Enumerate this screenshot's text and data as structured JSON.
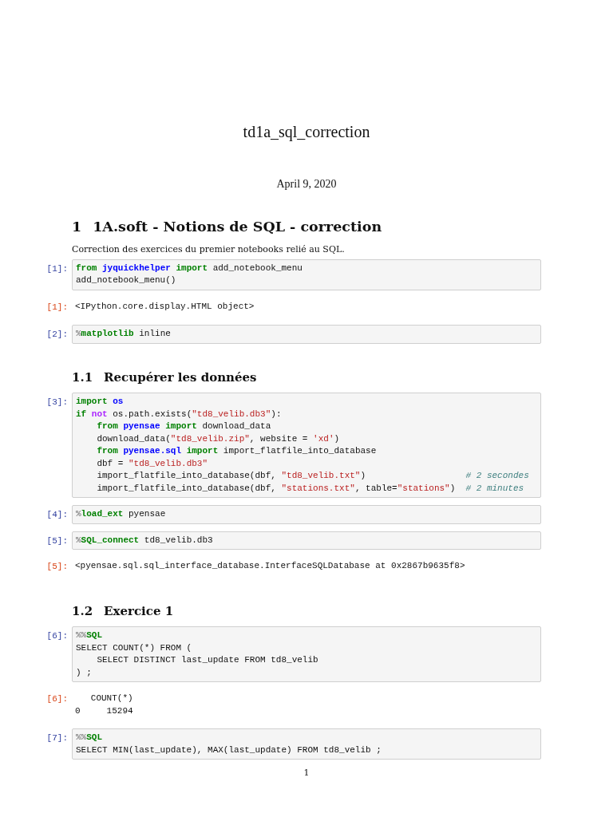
{
  "document": {
    "title": "td1a_sql_correction",
    "date": "April 9, 2020"
  },
  "cells": [
    {
      "kind": "section",
      "number": "1",
      "text": "1A.soft - Notions de SQL - correction"
    },
    {
      "kind": "paragraph",
      "text": "Correction des exercices du premier notebooks relié au SQL."
    },
    {
      "kind": "input",
      "prompt": "[1]:",
      "lines": [
        [
          {
            "kind": "kw",
            "text": "from "
          },
          {
            "kind": "ns",
            "text": "jyquickhelper "
          },
          {
            "kind": "kw",
            "text": "import"
          },
          {
            "kind": "plain",
            "text": " add_notebook_menu"
          }
        ],
        [
          {
            "kind": "plain",
            "text": "add_notebook_menu()"
          }
        ]
      ]
    },
    {
      "kind": "output",
      "prompt": "[1]:",
      "lines": [
        [
          {
            "kind": "plain",
            "text": "<IPython.core.display.HTML object>"
          }
        ]
      ]
    },
    {
      "kind": "input",
      "prompt": "[2]:",
      "lines": [
        [
          {
            "kind": "pct",
            "text": "%"
          },
          {
            "kind": "kw",
            "text": "matplotlib"
          },
          {
            "kind": "plain",
            "text": " inline"
          }
        ]
      ]
    },
    {
      "kind": "subsection",
      "number": "1.1",
      "text": "Recupérer les données"
    },
    {
      "kind": "input",
      "prompt": "[3]:",
      "lines": [
        [
          {
            "kind": "kw",
            "text": "import "
          },
          {
            "kind": "ns",
            "text": "os"
          }
        ],
        [
          {
            "kind": "kw",
            "text": "if "
          },
          {
            "kind": "opw",
            "text": "not"
          },
          {
            "kind": "plain",
            "text": " os.path.exists("
          },
          {
            "kind": "str",
            "text": "\"td8_velib.db3\""
          },
          {
            "kind": "plain",
            "text": "):"
          }
        ],
        [
          {
            "kind": "kw",
            "text": "    from "
          },
          {
            "kind": "ns",
            "text": "pyensae "
          },
          {
            "kind": "kw",
            "text": "import"
          },
          {
            "kind": "plain",
            "text": " download_data"
          }
        ],
        [
          {
            "kind": "plain",
            "text": "    download_data("
          },
          {
            "kind": "str",
            "text": "\"td8_velib.zip\""
          },
          {
            "kind": "plain",
            "text": ", website = "
          },
          {
            "kind": "str",
            "text": "'xd'"
          },
          {
            "kind": "plain",
            "text": ")"
          }
        ],
        [
          {
            "kind": "kw",
            "text": "    from "
          },
          {
            "kind": "ns",
            "text": "pyensae.sql "
          },
          {
            "kind": "kw",
            "text": "import"
          },
          {
            "kind": "plain",
            "text": " import_flatfile_into_database"
          }
        ],
        [
          {
            "kind": "plain",
            "text": "    dbf = "
          },
          {
            "kind": "str",
            "text": "\"td8_velib.db3\""
          }
        ],
        [
          {
            "kind": "plain",
            "text": "    import_flatfile_into_database(dbf, "
          },
          {
            "kind": "str",
            "text": "\"td8_velib.txt\""
          },
          {
            "kind": "plain",
            "text": ")                   "
          },
          {
            "kind": "cmt",
            "text": "# 2 secondes"
          }
        ],
        [
          {
            "kind": "plain",
            "text": "    import_flatfile_into_database(dbf, "
          },
          {
            "kind": "str",
            "text": "\"stations.txt\""
          },
          {
            "kind": "plain",
            "text": ", table="
          },
          {
            "kind": "str",
            "text": "\"stations\""
          },
          {
            "kind": "plain",
            "text": ")  "
          },
          {
            "kind": "cmt",
            "text": "# 2 minutes"
          }
        ]
      ]
    },
    {
      "kind": "input",
      "prompt": "[4]:",
      "lines": [
        [
          {
            "kind": "pct",
            "text": "%"
          },
          {
            "kind": "kw",
            "text": "load_ext"
          },
          {
            "kind": "plain",
            "text": " pyensae"
          }
        ]
      ]
    },
    {
      "kind": "input",
      "prompt": "[5]:",
      "lines": [
        [
          {
            "kind": "pct",
            "text": "%"
          },
          {
            "kind": "kw",
            "text": "SQL_connect"
          },
          {
            "kind": "plain",
            "text": " td8_velib.db3"
          }
        ]
      ]
    },
    {
      "kind": "output",
      "prompt": "[5]:",
      "lines": [
        [
          {
            "kind": "plain",
            "text": "<pyensae.sql.sql_interface_database.InterfaceSQLDatabase at 0x2867b9635f8>"
          }
        ]
      ]
    },
    {
      "kind": "subsection",
      "number": "1.2",
      "text": "Exercice 1"
    },
    {
      "kind": "input",
      "prompt": "[6]:",
      "lines": [
        [
          {
            "kind": "pct",
            "text": "%%"
          },
          {
            "kind": "kw",
            "text": "SQL"
          }
        ],
        [
          {
            "kind": "plain",
            "text": "SELECT COUNT(*) FROM ("
          }
        ],
        [
          {
            "kind": "plain",
            "text": "    SELECT DISTINCT last_update FROM td8_velib"
          }
        ],
        [
          {
            "kind": "plain",
            "text": ") ;"
          }
        ]
      ]
    },
    {
      "kind": "output",
      "prompt": "[6]:",
      "lines": [
        [
          {
            "kind": "plain",
            "text": "   COUNT(*)"
          }
        ],
        [
          {
            "kind": "plain",
            "text": "0     15294"
          }
        ]
      ]
    },
    {
      "kind": "input",
      "prompt": "[7]:",
      "lines": [
        [
          {
            "kind": "pct",
            "text": "%%"
          },
          {
            "kind": "kw",
            "text": "SQL"
          }
        ],
        [
          {
            "kind": "plain",
            "text": "SELECT MIN(last_update), MAX(last_update) FROM td8_velib ;"
          }
        ]
      ]
    }
  ],
  "page_number": "1"
}
